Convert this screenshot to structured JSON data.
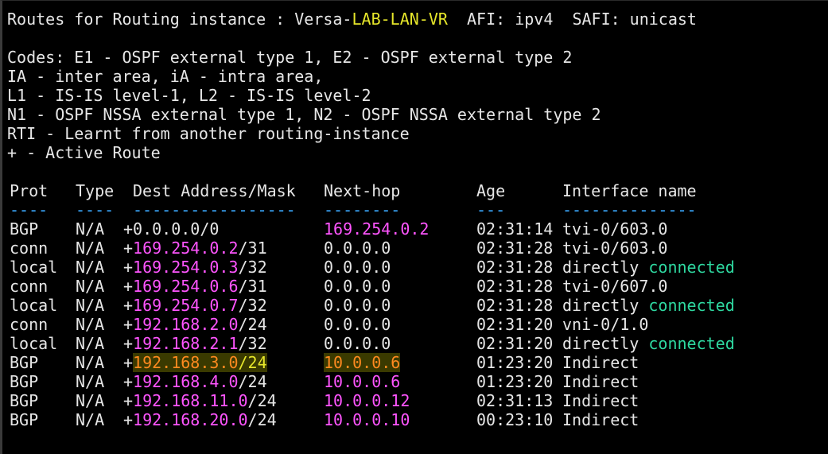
{
  "colors": {
    "background": "#000000",
    "text": "#e6e6e6",
    "yellow": "#e6e62a",
    "magenta": "#ff55ff",
    "green": "#2ed8a0",
    "cyan": "#3ba9ff",
    "highlight": "#ff8a1f"
  },
  "header": {
    "prefix": "Routes for Routing instance : Versa-",
    "instance_name": "LAB-LAN-VR",
    "afi": "  AFI: ipv4  SAFI: unicast"
  },
  "codes": [
    "Codes: E1 - OSPF external type 1, E2 - OSPF external type 2",
    "IA - inter area, iA - intra area,",
    "L1 - IS-IS level-1, L2 - IS-IS level-2",
    "N1 - OSPF NSSA external type 1, N2 - OSPF NSSA external type 2",
    "RTI - Learnt from another routing-instance",
    "+ - Active Route"
  ],
  "table": {
    "headers": [
      "Prot",
      "Type",
      "Dest Address/Mask",
      "Next-hop",
      "Age",
      "Interface name"
    ],
    "separators": [
      "----",
      "----",
      "-----------------",
      "--------",
      "---",
      "--------------"
    ],
    "rows": [
      {
        "prot": "BGP",
        "type": "N/A",
        "plus": "+",
        "dest_ip": "0.0.0.0",
        "mask": "/0",
        "next_hop": "169.254.0.2",
        "age": "02:31:14",
        "iface": "tvi-0/603.0",
        "iface_suffix": ""
      },
      {
        "prot": "conn",
        "type": "N/A",
        "plus": "+",
        "dest_ip": "169.254.0.2",
        "mask": "/31",
        "next_hop": "0.0.0.0",
        "age": "02:31:28",
        "iface": "tvi-0/603.0",
        "iface_suffix": ""
      },
      {
        "prot": "local",
        "type": "N/A",
        "plus": "+",
        "dest_ip": "169.254.0.3",
        "mask": "/32",
        "next_hop": "0.0.0.0",
        "age": "02:31:28",
        "iface": "directly ",
        "iface_suffix": "connected"
      },
      {
        "prot": "conn",
        "type": "N/A",
        "plus": "+",
        "dest_ip": "169.254.0.6",
        "mask": "/31",
        "next_hop": "0.0.0.0",
        "age": "02:31:28",
        "iface": "tvi-0/607.0",
        "iface_suffix": ""
      },
      {
        "prot": "local",
        "type": "N/A",
        "plus": "+",
        "dest_ip": "169.254.0.7",
        "mask": "/32",
        "next_hop": "0.0.0.0",
        "age": "02:31:28",
        "iface": "directly ",
        "iface_suffix": "connected"
      },
      {
        "prot": "conn",
        "type": "N/A",
        "plus": "+",
        "dest_ip": "192.168.2.0",
        "mask": "/24",
        "next_hop": "0.0.0.0",
        "age": "02:31:20",
        "iface": "vni-0/1.0",
        "iface_suffix": ""
      },
      {
        "prot": "local",
        "type": "N/A",
        "plus": "+",
        "dest_ip": "192.168.2.1",
        "mask": "/32",
        "next_hop": "0.0.0.0",
        "age": "02:31:20",
        "iface": "directly ",
        "iface_suffix": "connected"
      },
      {
        "prot": "BGP",
        "type": "N/A",
        "plus": "+",
        "dest_ip": "192.168.3.0",
        "mask": "/24",
        "next_hop": "10.0.0.6",
        "age": "01:23:20",
        "iface": "Indirect",
        "iface_suffix": ""
      },
      {
        "prot": "BGP",
        "type": "N/A",
        "plus": "+",
        "dest_ip": "192.168.4.0",
        "mask": "/24",
        "next_hop": "10.0.0.6",
        "age": "01:23:20",
        "iface": "Indirect",
        "iface_suffix": ""
      },
      {
        "prot": "BGP",
        "type": "N/A",
        "plus": "+",
        "dest_ip": "192.168.11.0",
        "mask": "/24",
        "next_hop": "10.0.0.12",
        "age": "02:31:13",
        "iface": "Indirect",
        "iface_suffix": ""
      },
      {
        "prot": "BGP",
        "type": "N/A",
        "plus": "+",
        "dest_ip": "192.168.20.0",
        "mask": "/24",
        "next_hop": "10.0.0.10",
        "age": "00:23:10",
        "iface": "Indirect",
        "iface_suffix": ""
      }
    ]
  }
}
